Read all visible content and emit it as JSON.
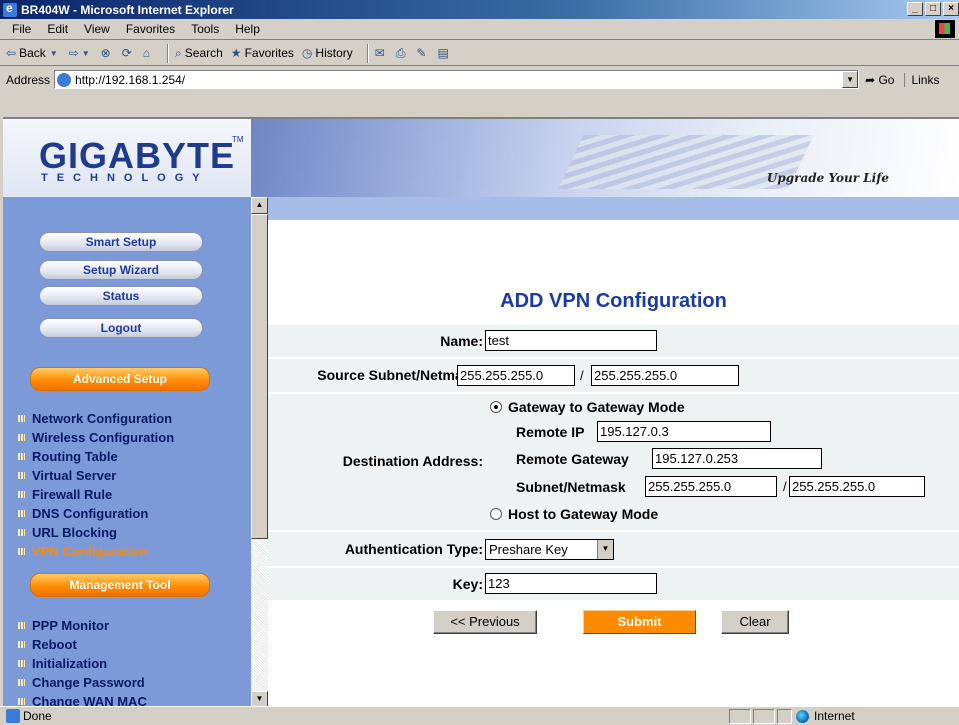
{
  "window": {
    "title": "BR404W - Microsoft Internet Explorer",
    "controls": [
      "_",
      "□",
      "×"
    ]
  },
  "menubar": [
    "File",
    "Edit",
    "View",
    "Favorites",
    "Tools",
    "Help"
  ],
  "toolbar": {
    "back": "Back",
    "search": "Search",
    "favorites": "Favorites",
    "history": "History"
  },
  "addressbar": {
    "label": "Address",
    "url": "http://192.168.1.254/",
    "go": "Go",
    "links": "Links"
  },
  "banner": {
    "logo": "GIGABYTE",
    "logo_sub": "TECHNOLOGY",
    "slogan": "Upgrade Your Life"
  },
  "sidebar": {
    "buttons": [
      "Smart Setup",
      "Setup Wizard",
      "Status",
      "Logout"
    ],
    "advanced_title": "Advanced Setup",
    "advanced_items": [
      "Network Configuration",
      "Wireless Configuration",
      "Routing Table",
      "Virtual Server",
      "Firewall Rule",
      "DNS Configuration",
      "URL Blocking",
      "VPN Configuration"
    ],
    "active_item": "VPN Configuration",
    "management_title": "Management Tool",
    "management_items": [
      "PPP Monitor",
      "Reboot",
      "Initialization",
      "Change Password",
      "Change WAN MAC"
    ]
  },
  "form": {
    "title": "ADD VPN Configuration",
    "name_label": "Name:",
    "name_value": "test",
    "source_label": "Source Subnet/Netmask:",
    "source_subnet": "255.255.255.0",
    "source_netmask": "255.255.255.0",
    "slash": "/",
    "dest_label": "Destination Address:",
    "mode_gateway": "Gateway to Gateway Mode",
    "mode_host": "Host to Gateway Mode",
    "selected_mode": "Gateway to Gateway Mode",
    "remote_ip_label": "Remote IP",
    "remote_ip": "195.127.0.3",
    "remote_gateway_label": "Remote Gateway",
    "remote_gateway": "195.127.0.253",
    "dest_subnet_label": "Subnet/Netmask",
    "dest_subnet": "255.255.255.0",
    "dest_netmask": "255.255.255.0",
    "auth_label": "Authentication Type:",
    "auth_value": "Preshare Key",
    "key_label": "Key:",
    "key_value": "123",
    "btn_previous": "<< Previous",
    "btn_submit": "Submit",
    "btn_clear": "Clear"
  },
  "statusbar": {
    "text": "Done",
    "zone": "Internet"
  },
  "colors": {
    "sidebar": "#7c9ad8",
    "accent_orange": "#ff8c00",
    "title_blue": "#1b3aa5",
    "row_bg": "#eef2f3"
  }
}
